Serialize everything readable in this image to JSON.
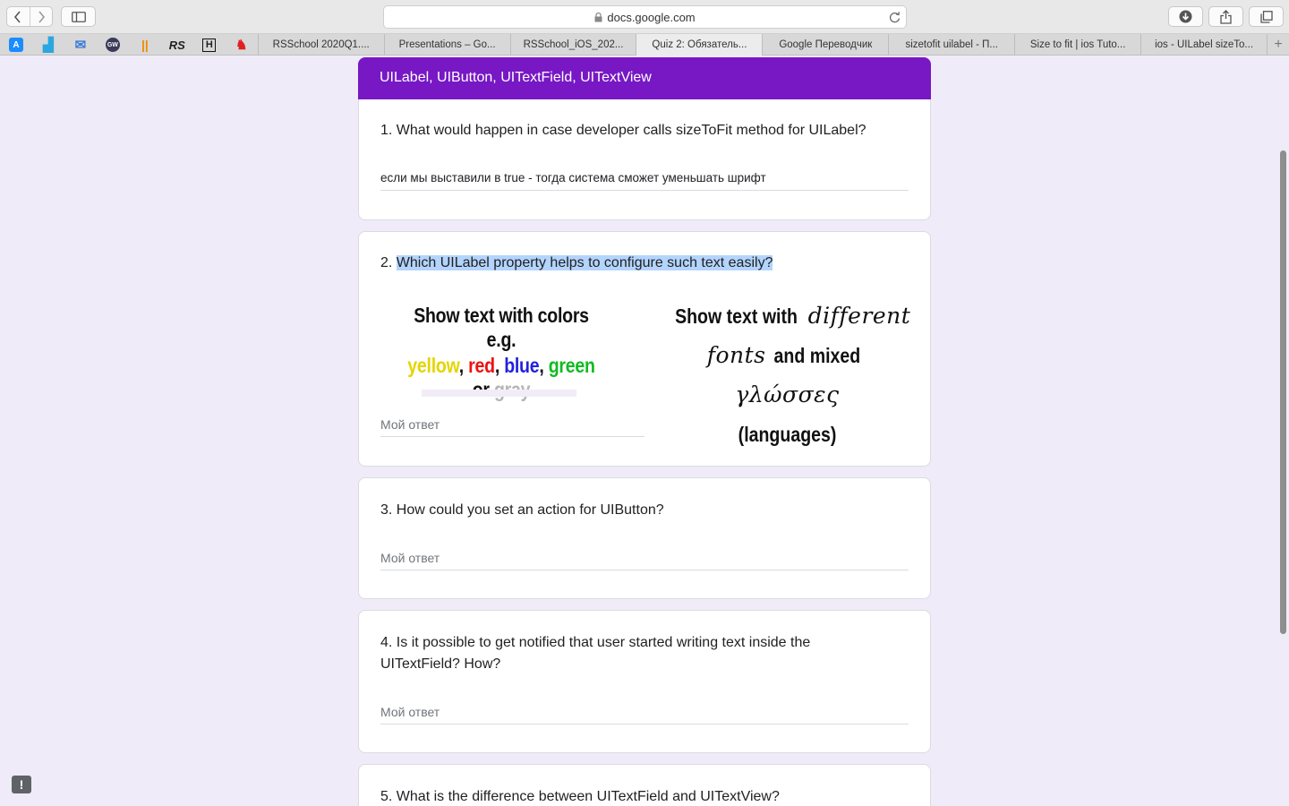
{
  "browser": {
    "url": "docs.google.com",
    "favicons": [
      {
        "name": "appstore-icon",
        "glyph": "A",
        "color": "#1a8cff"
      },
      {
        "name": "analytics-icon",
        "glyph": "▟",
        "color": "#2aa7e0"
      },
      {
        "name": "mail-icon",
        "glyph": "✉",
        "color": "#3d7bd9"
      },
      {
        "name": "gw-icon",
        "glyph": "GW",
        "color": "#3a3a5a"
      },
      {
        "name": "pause-icon",
        "glyph": "||",
        "color": "#f08a00"
      },
      {
        "name": "rs-icon",
        "glyph": "RS",
        "color": "#222222"
      },
      {
        "name": "hh-icon",
        "glyph": "H",
        "color": "#111111"
      },
      {
        "name": "cat-icon",
        "glyph": "♞",
        "color": "#e02020"
      }
    ],
    "tabs": [
      {
        "label": "RSSchool 2020Q1....",
        "active": false
      },
      {
        "label": "Presentations – Go...",
        "active": false
      },
      {
        "label": "RSSchool_iOS_202...",
        "active": false
      },
      {
        "label": "Quiz 2: Обязатель...",
        "active": true
      },
      {
        "label": "Google Переводчик",
        "active": false
      },
      {
        "label": "sizetofit uilabel - П...",
        "active": false
      },
      {
        "label": "Size to fit | ios Tuto...",
        "active": false
      },
      {
        "label": "ios - UILabel sizeTo...",
        "active": false
      }
    ],
    "add_tab": "+"
  },
  "form": {
    "section_title": "UILabel, UIButton, UITextField, UITextView",
    "questions": [
      {
        "number": "1.",
        "text": "What would happen in case developer calls sizeToFit method for UILabel?",
        "answer": "если мы выставили в true - тогда система сможет уменьшать шрифт"
      },
      {
        "number": "2.",
        "text": "Which UILabel property helps to configure such text easily?",
        "placeholder": "Мой ответ",
        "image": {
          "left_line1": "Show text with colors e.g.",
          "colors": [
            {
              "word": "yellow",
              "color": "#e5d500"
            },
            {
              "sep": ", "
            },
            {
              "word": "red",
              "color": "#ee1111"
            },
            {
              "sep": ", "
            },
            {
              "word": "blue",
              "color": "#2222dd"
            },
            {
              "sep": ", "
            },
            {
              "word": "green",
              "color": "#11bb22"
            },
            {
              "sep": " or "
            },
            {
              "word": "gray",
              "color": "#b5b5b5"
            }
          ],
          "right_line1_plain": "Show text with ",
          "right_line1_script": "different",
          "right_line2_script": "fonts",
          "right_line2_plain": " and mixed ",
          "right_line2_greek": "γλώσσες",
          "right_line3": "(languages)"
        }
      },
      {
        "number": "3.",
        "text": "How could you set an action for UIButton?",
        "placeholder": "Мой ответ"
      },
      {
        "number": "4.",
        "text": "Is it possible to get notified that user started writing text inside the UITextField? How?",
        "placeholder": "Мой ответ"
      },
      {
        "number": "5.",
        "text": "What is the difference between UITextField and UITextView?"
      }
    ]
  },
  "feedback_glyph": "!"
}
